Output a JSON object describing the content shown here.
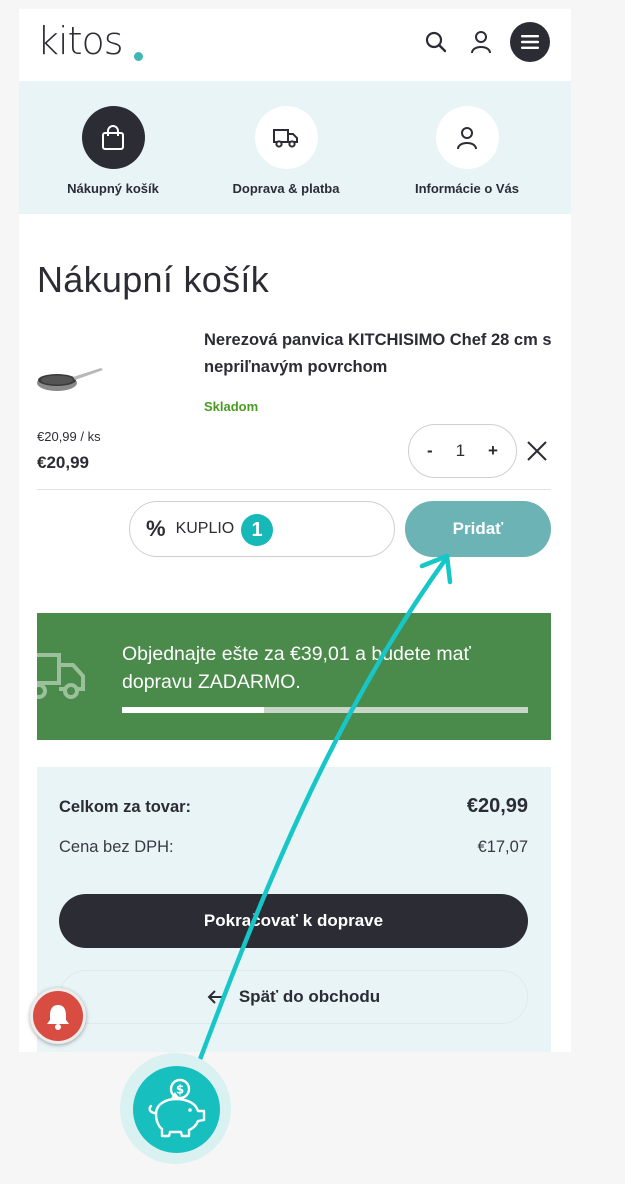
{
  "header": {
    "logo_text": "kitos",
    "icons": [
      "search-icon",
      "user-icon",
      "menu-icon"
    ]
  },
  "steps": [
    {
      "label": "Nákupný košík",
      "icon": "bag-icon",
      "active": true
    },
    {
      "label": "Doprava & platba",
      "icon": "truck-icon",
      "active": false
    },
    {
      "label": "Informácie o Vás",
      "icon": "user-icon",
      "active": false
    }
  ],
  "cart": {
    "title": "Nákupní košík",
    "item": {
      "name": "Nerezová panvica KITCHISIMO Chef 28 cm s nepriľnavým povrchom",
      "stock": "Skladom",
      "unit_price": "€20,99 / ks",
      "total_price": "€20,99",
      "qty_minus": "-",
      "quantity": "1",
      "qty_plus": "+"
    }
  },
  "coupon": {
    "value": "KUPLIO",
    "badge": "1",
    "add_label": "Pridať"
  },
  "shipping_banner": {
    "text": "Objednajte ešte za €39,01 a budete mať dopravu ZADARMO.",
    "progress_fraction": 0.35
  },
  "summary": {
    "total_label": "Celkom za tovar:",
    "total_value": "€20,99",
    "net_label": "Cena bez DPH:",
    "net_value": "€17,07",
    "continue_label": "Pokračovať k doprave",
    "back_label": "Späť do obchodu"
  },
  "colors": {
    "dark": "#2c2c35",
    "teal": "#17b8b8",
    "add_button": "#6bb3b4",
    "banner_green": "#4a8a4a",
    "stock_green": "#4a9a23",
    "light_blue": "#e9f4f7",
    "bell_red": "#d94c41"
  }
}
